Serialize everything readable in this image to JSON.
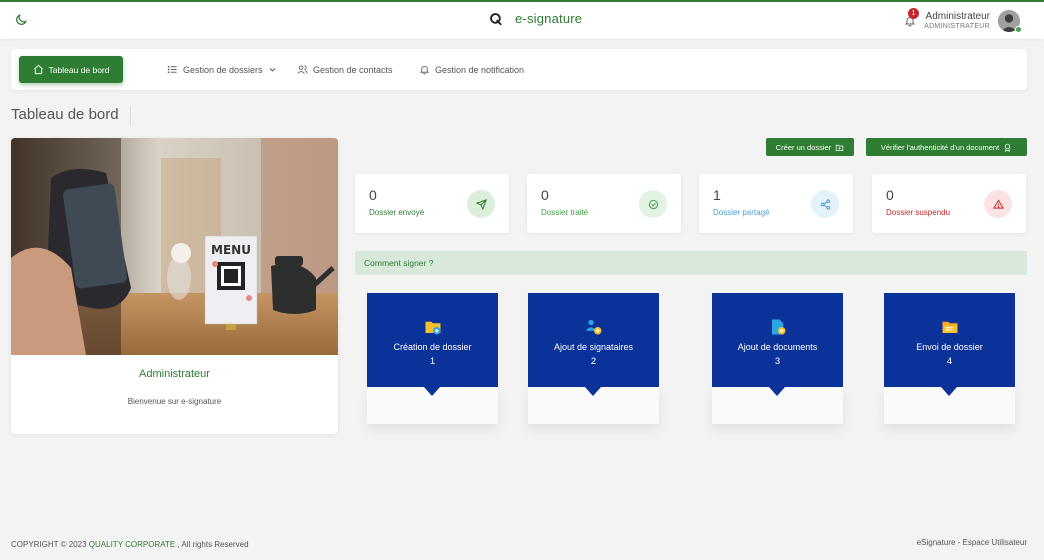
{
  "header": {
    "brand": "e-signature",
    "notification_count": "1",
    "user_name": "Administrateur",
    "user_role": "ADMINISTRATEUR"
  },
  "nav": {
    "dashboard": "Tableau de bord",
    "folders": "Gestion de dossiers",
    "contacts": "Gestion de contacts",
    "notifications": "Gestion de notification"
  },
  "page": {
    "title": "Tableau de bord"
  },
  "profile": {
    "image_text": "MENU",
    "name": "Administrateur",
    "welcome": "Bienvenue sur e-signature"
  },
  "actions": {
    "create_folder": "Créer un dossier",
    "verify_document": "Vérifier l'authenticité d'un document"
  },
  "stats": [
    {
      "value": "0",
      "label": "Dossier envoyé",
      "color": "#2e7d32",
      "bg": "#dcefdc",
      "icon": "send-icon"
    },
    {
      "value": "0",
      "label": "Dossier traité",
      "color": "#43a047",
      "bg": "#e3f2e4",
      "icon": "check-circle-icon"
    },
    {
      "value": "1",
      "label": "Dossier partagé",
      "color": "#4a9fd8",
      "bg": "#e3f2fb",
      "icon": "share-icon"
    },
    {
      "value": "0",
      "label": "Dossier suspendu",
      "color": "#c62828",
      "bg": "#fbe3e3",
      "icon": "warning-icon"
    }
  ],
  "howto": {
    "label": "Comment signer ?"
  },
  "steps": [
    {
      "title": "Création de dossier",
      "num": "1",
      "icon": "folder-add-icon"
    },
    {
      "title": "Ajout de signataires",
      "num": "2",
      "icon": "users-add-icon"
    },
    {
      "title": "Ajout de documents",
      "num": "3",
      "icon": "document-add-icon"
    },
    {
      "title": "Envoi de dossier",
      "num": "4",
      "icon": "folder-send-icon"
    }
  ],
  "footer": {
    "copyright": "COPYRIGHT © 2023",
    "company": "QUALITY CORPORATE",
    "rights": ", All rights Reserved",
    "right_text": "eSignature - Espace Utilisateur"
  },
  "colors": {
    "primary": "#2e7d32",
    "step_blue": "#0a3299"
  }
}
